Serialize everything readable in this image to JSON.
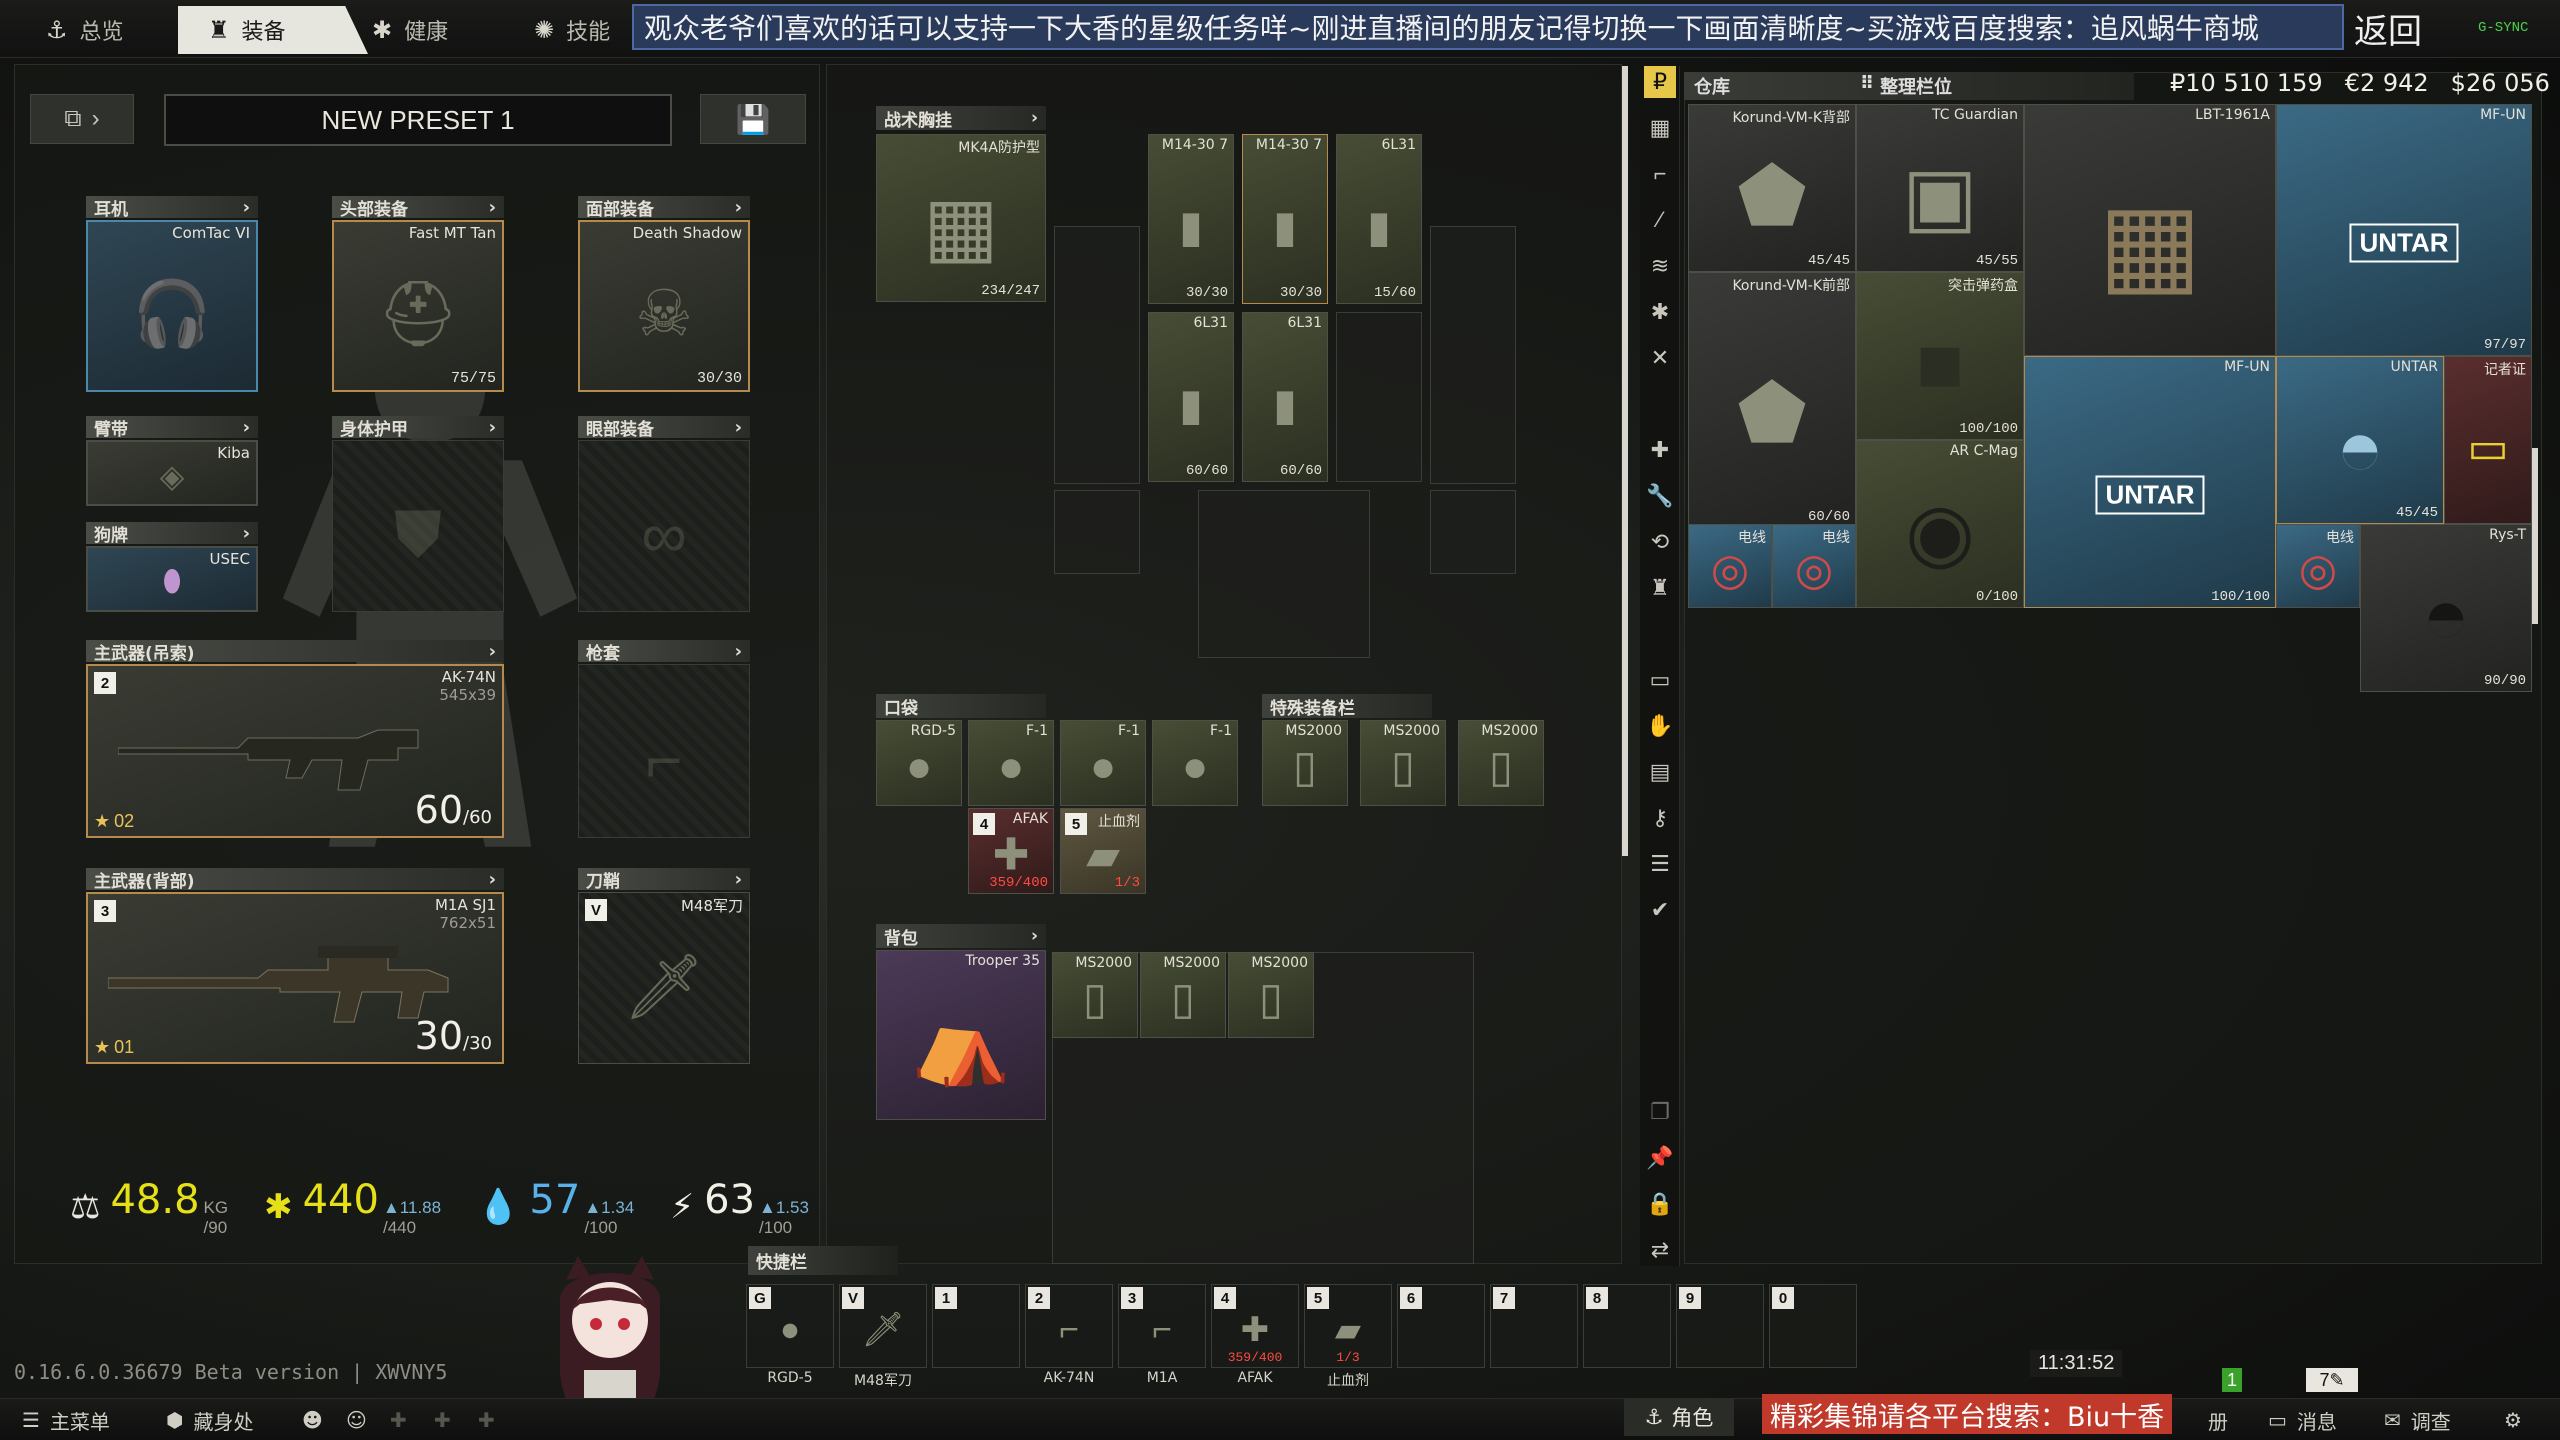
{
  "top_tabs": [
    {
      "icon": "⚓",
      "label": "总览"
    },
    {
      "icon": "♜",
      "label": "装备"
    },
    {
      "icon": "✱",
      "label": "健康"
    },
    {
      "icon": "✺",
      "label": "技能"
    }
  ],
  "banner": "观众老爷们喜欢的话可以支持一下大香的星级任务咩~刚进直播间的朋友记得切换一下画面清晰度~买游戏百度搜索：追风蜗牛商城",
  "back_label": "返回",
  "gsync": "G-SYNC",
  "preset": {
    "name": "NEW PRESET 1"
  },
  "slots": {
    "earpiece": {
      "header": "耳机",
      "item": "ComTac VI"
    },
    "headwear": {
      "header": "头部装备",
      "item": "Fast MT Tan",
      "count": "75/75"
    },
    "face": {
      "header": "面部装备",
      "item": "Death Shadow",
      "count": "30/30"
    },
    "armband": {
      "header": "臂带",
      "item": "Kiba"
    },
    "body_armor": {
      "header": "身体护甲"
    },
    "eyewear": {
      "header": "眼部装备"
    },
    "dogtag": {
      "header": "狗牌",
      "item": "USEC"
    },
    "primary1": {
      "header": "主武器(吊索)",
      "item": "AK-74N",
      "caliber": "545x39",
      "slot": "2",
      "ammo": "60",
      "ammo_max": "/60",
      "stars": "02"
    },
    "holster": {
      "header": "枪套"
    },
    "primary2": {
      "header": "主武器(背部)",
      "item": "M1A SJ1",
      "caliber": "762x51",
      "slot": "3",
      "ammo": "30",
      "ammo_max": "/30",
      "stars": "01"
    },
    "sheath": {
      "header": "刀鞘",
      "item": "M48军刀",
      "slot": "V"
    }
  },
  "stats": {
    "weight": "48.8",
    "weight_unit": "KG",
    "weight_max": "/90",
    "energy": "440",
    "energy_max": "/440",
    "energy_delta": "▲11.88",
    "hydration": "57",
    "hydration_max": "/100",
    "hydration_delta": "▲1.34",
    "stamina": "63",
    "stamina_max": "/100",
    "stamina_delta": "▲1.53"
  },
  "rig": {
    "header": "战术胸挂",
    "item": "MK4A防护型",
    "count": "234/247",
    "mags": [
      {
        "name": "M14-30 7",
        "count": "30/30"
      },
      {
        "name": "M14-30 7",
        "count": "30/30"
      },
      {
        "name": "6L31",
        "count": "15/60"
      },
      {
        "name": "6L31",
        "count": "60/60"
      },
      {
        "name": "6L31",
        "count": "60/60"
      }
    ]
  },
  "pockets": {
    "header": "口袋",
    "items": [
      {
        "name": "RGD-5"
      },
      {
        "name": "F-1"
      },
      {
        "name": "F-1"
      },
      {
        "name": "F-1"
      },
      {
        "name": "AFAK",
        "badge": "4",
        "count": "359/400"
      },
      {
        "name": "止血剂",
        "badge": "5",
        "count": "1/3"
      }
    ]
  },
  "special": {
    "header": "特殊装备栏",
    "items": [
      "MS2000",
      "MS2000",
      "MS2000"
    ]
  },
  "backpack": {
    "header": "背包",
    "item": "Trooper 35",
    "contents": [
      "MS2000",
      "MS2000",
      "MS2000"
    ]
  },
  "warehouse": {
    "header": "仓库",
    "sort_label": "整理栏位",
    "money": {
      "rub": "₽10 510 159",
      "eur": "€2 942",
      "usd": "$26 056"
    },
    "items": [
      {
        "name": "Korund-VM-K背部",
        "count": "45/45"
      },
      {
        "name": "TC Guardian",
        "count": "45/55"
      },
      {
        "name": "LBT-1961A"
      },
      {
        "name": "MF-UN",
        "count": "97/97",
        "label": "UNTAR"
      },
      {
        "name": "Korund-VM-K前部",
        "count": "60/60"
      },
      {
        "name": "突击弹药盒",
        "count": "100/100"
      },
      {
        "name": "MF-UN",
        "count": "100/100",
        "label": "UNTAR"
      },
      {
        "name": "UNTAR",
        "count": "45/45"
      },
      {
        "name": "记者证"
      },
      {
        "name": "AR C-Mag",
        "count": "0/100"
      },
      {
        "name": "电线"
      },
      {
        "name": "电线"
      },
      {
        "name": "电线"
      },
      {
        "name": "Rys-T",
        "count": "90/90"
      }
    ]
  },
  "quickbar": {
    "header": "快捷栏",
    "slots": [
      {
        "key": "G",
        "label": "RGD-5"
      },
      {
        "key": "V",
        "label": "M48军刀"
      },
      {
        "key": "1",
        "label": ""
      },
      {
        "key": "2",
        "label": "AK-74N"
      },
      {
        "key": "3",
        "label": "M1A"
      },
      {
        "key": "4",
        "label": "AFAK",
        "count": "359/400"
      },
      {
        "key": "5",
        "label": "止血剂",
        "count": "1/3"
      },
      {
        "key": "6",
        "label": ""
      },
      {
        "key": "7",
        "label": ""
      },
      {
        "key": "8",
        "label": ""
      },
      {
        "key": "9",
        "label": ""
      },
      {
        "key": "0",
        "label": ""
      }
    ]
  },
  "version": "0.16.6.0.36679 Beta version | XWVNY5",
  "clock": "11:31:52",
  "bottom": {
    "main_menu": "主菜单",
    "hideout": "藏身处",
    "character": "角色",
    "promo": "精彩集锦请各平台搜索：Biu十香",
    "register": "册",
    "messages": "消息",
    "survey": "调查",
    "badge1": "1",
    "badge7": "7"
  },
  "colors": {
    "banner_bg": "#2a3a5a",
    "promo_bg": "#c0392b",
    "energy": "#e6e018",
    "hydration": "#5ab0e8",
    "weight": "#e6e018"
  }
}
